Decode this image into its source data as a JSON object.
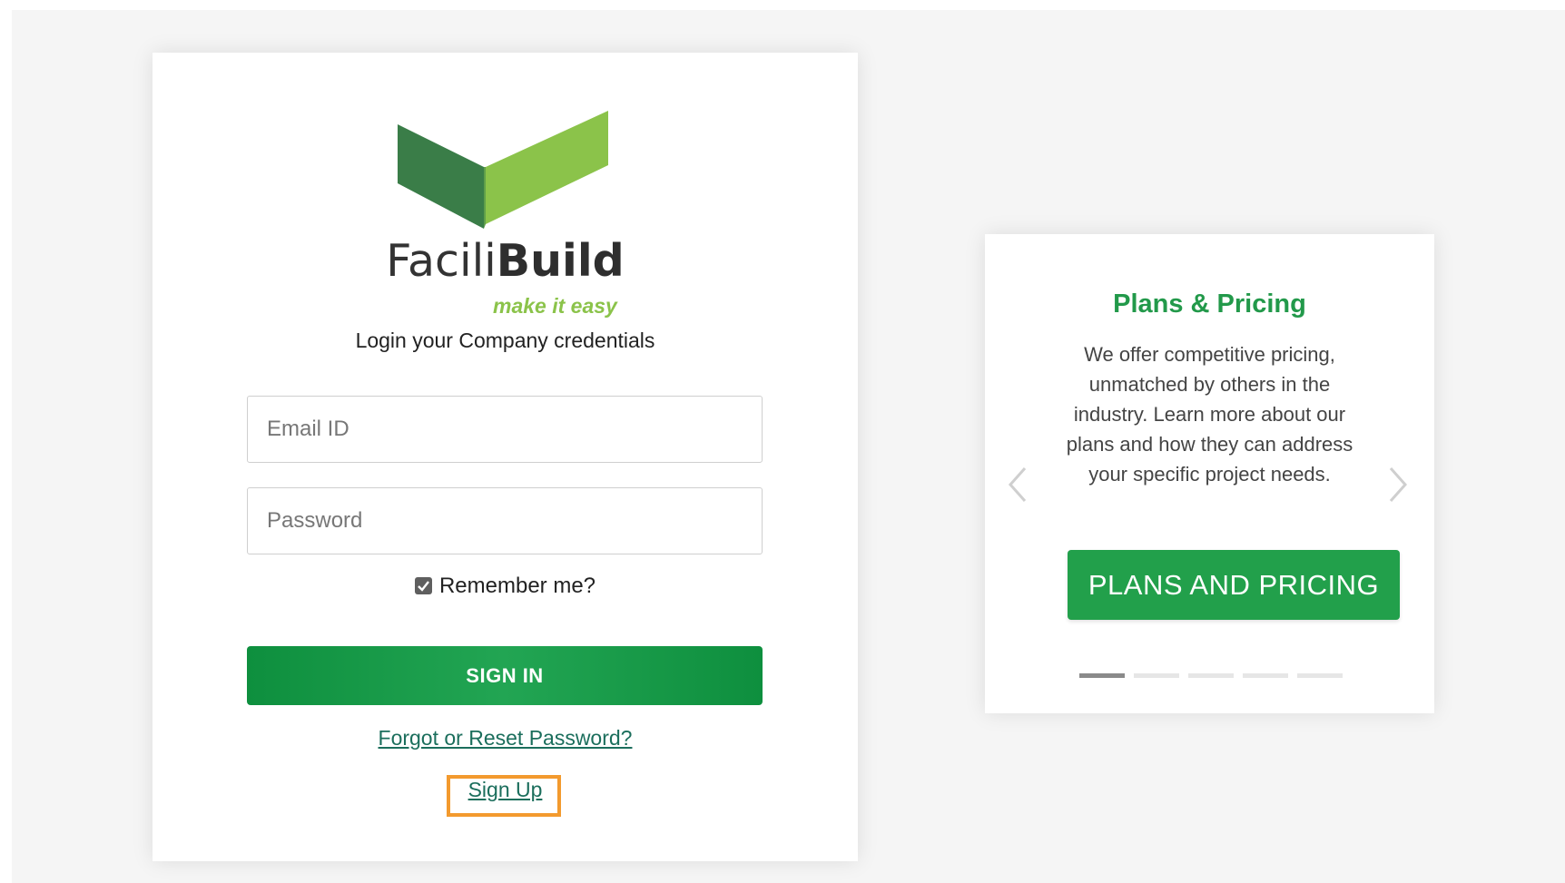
{
  "login": {
    "brand_light": "Facili",
    "brand_bold": "Build",
    "tagline": "make it easy",
    "subtitle": "Login your Company credentials",
    "email_placeholder": "Email ID",
    "password_placeholder": "Password",
    "remember_label": "Remember me?",
    "remember_checked": true,
    "signin_label": "SIGN IN",
    "forgot_label": "Forgot or Reset Password?",
    "signup_label": "Sign Up"
  },
  "promo": {
    "title": "Plans & Pricing",
    "text": "We offer competitive pricing, unmatched by others in the industry. Learn more about our plans and how they can address your specific project needs.",
    "button_label": "PLANS AND PRICING",
    "slide_count": 5,
    "active_slide": 1,
    "prev_icon": "chevron-left-icon",
    "next_icon": "chevron-right-icon"
  },
  "colors": {
    "brand_green": "#22a04b",
    "logo_dark_green": "#3a7d48",
    "logo_light_green": "#8bc34a",
    "link_color": "#1b6e5c",
    "highlight_orange": "#f39a2e"
  }
}
